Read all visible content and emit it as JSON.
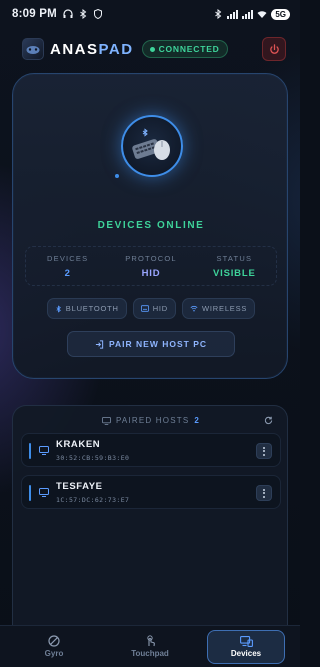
{
  "status_bar": {
    "time": "8:09 PM",
    "battery": "5G"
  },
  "header": {
    "brand_main": "ANAS",
    "brand_accent": "PAD",
    "connection_status": "CONNECTED"
  },
  "device_card": {
    "title": "DEVICES ONLINE",
    "stats": [
      {
        "label": "DEVICES",
        "value": "2"
      },
      {
        "label": "PROTOCOL",
        "value": "HID"
      },
      {
        "label": "STATUS",
        "value": "VISIBLE"
      }
    ],
    "chips": [
      "BLUETOOTH",
      "HID",
      "WIRELESS"
    ],
    "pair_button": "PAIR NEW HOST PC"
  },
  "paired_hosts": {
    "title": "PAIRED HOSTS",
    "count": "2",
    "hosts": [
      {
        "name": "KRAKEN",
        "mac": "30:52:CB:59:B3:E0"
      },
      {
        "name": "TESFAYE",
        "mac": "1C:57:DC:62:73:E7"
      }
    ]
  },
  "bottom_nav": {
    "tabs": [
      {
        "label": "Gyro",
        "icon": "gyro-icon"
      },
      {
        "label": "Touchpad",
        "icon": "touch-icon"
      },
      {
        "label": "Devices",
        "icon": "devices-icon"
      }
    ],
    "active_tab": "Devices"
  },
  "colors": {
    "accent_blue": "#3e8de8",
    "connected_green": "#3ed39a",
    "danger_red": "#e05555",
    "background": "#0b1019"
  }
}
